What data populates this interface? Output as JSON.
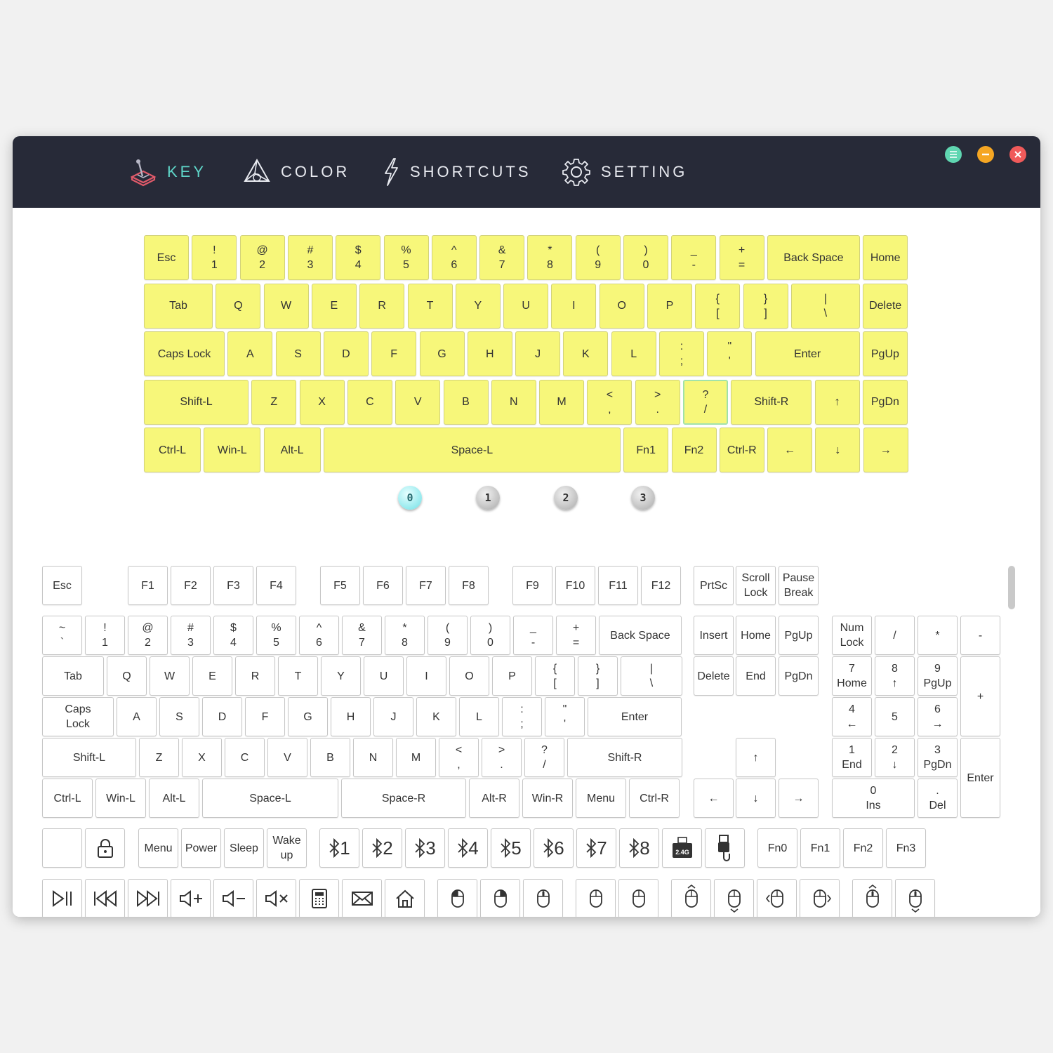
{
  "nav": {
    "key": "KEY",
    "color": "COLOR",
    "shortcuts": "SHORTCUTS",
    "setting": "SETTING"
  },
  "window_buttons": {
    "menu_color": "#5fd6b1",
    "minimize_color": "#f5a623",
    "close_color": "#f05a5a"
  },
  "colors": {
    "accent": "#5fd6c9",
    "key_highlight": "#f7f77a",
    "topbar": "#272a38"
  },
  "layers": [
    "0",
    "1",
    "2",
    "3"
  ],
  "active_layer": "0",
  "keymap_layout_rows": [
    [
      "Esc",
      "! 1",
      "@ 2",
      "# 3",
      "$ 4",
      "% 5",
      "^ 6",
      "& 7",
      "* 8",
      "( 9",
      ") 0",
      "_ -",
      "+ =",
      "Back Space",
      "Home"
    ],
    [
      "Tab",
      "Q",
      "W",
      "E",
      "R",
      "T",
      "Y",
      "U",
      "I",
      "O",
      "P",
      "{ [",
      "} ]",
      "| \\",
      "Delete"
    ],
    [
      "Caps Lock",
      "A",
      "S",
      "D",
      "F",
      "G",
      "H",
      "J",
      "K",
      "L",
      ": ;",
      "\" '",
      "Enter",
      "PgUp"
    ],
    [
      "Shift-L",
      "Z",
      "X",
      "C",
      "V",
      "B",
      "N",
      "M",
      "< ,",
      "> .",
      "? /",
      "Shift-R",
      "↑",
      "PgDn"
    ],
    [
      "Ctrl-L",
      "Win-L",
      "Alt-L",
      "Space-L",
      "Fn1",
      "Fn2",
      "Ctrl-R",
      "←",
      "↓",
      "→"
    ]
  ],
  "selected_key": "? /",
  "palette": {
    "function_row": [
      "Esc",
      "F1",
      "F2",
      "F3",
      "F4",
      "F5",
      "F6",
      "F7",
      "F8",
      "F9",
      "F10",
      "F11",
      "F12",
      "PrtSc",
      "Scroll Lock",
      "Pause Break"
    ],
    "number_row": [
      "~ `",
      "! 1",
      "@ 2",
      "# 3",
      "$ 4",
      "% 5",
      "^ 6",
      "& 7",
      "* 8",
      "( 9",
      ") 0",
      "_ -",
      "+ =",
      "Back Space"
    ],
    "qwerty_row": [
      "Tab",
      "Q",
      "W",
      "E",
      "R",
      "T",
      "Y",
      "U",
      "I",
      "O",
      "P",
      "{ [",
      "} ]",
      "| \\"
    ],
    "home_row": [
      "Caps Lock",
      "A",
      "S",
      "D",
      "F",
      "G",
      "H",
      "J",
      "K",
      "L",
      ": ;",
      "\" '",
      "Enter"
    ],
    "shift_row": [
      "Shift-L",
      "Z",
      "X",
      "C",
      "V",
      "B",
      "N",
      "M",
      "< ,",
      "> .",
      "? /",
      "Shift-R"
    ],
    "bottom_row": [
      "Ctrl-L",
      "Win-L",
      "Alt-L",
      "Space-L",
      "Space-R",
      "Alt-R",
      "Win-R",
      "Menu",
      "Ctrl-R"
    ],
    "nav_cluster": [
      "Insert",
      "Home",
      "PgUp",
      "Delete",
      "End",
      "PgDn",
      "↑",
      "←",
      "↓",
      "→"
    ],
    "numpad": [
      "Num Lock",
      "/",
      "*",
      "-",
      "7 Home",
      "8 ↑",
      "9 PgUp",
      "+",
      "4 ←",
      "5",
      "6 →",
      "1 End",
      "2 ↓",
      "3 PgDn",
      "Enter",
      "0 Ins",
      ". Del"
    ],
    "system_row": [
      "Menu",
      "Power",
      "Sleep",
      "Wake up"
    ],
    "bluetooth": [
      "1",
      "2",
      "3",
      "4",
      "5",
      "6",
      "7",
      "8"
    ],
    "dongle_label": "2.4G",
    "fn_keys": [
      "Fn0",
      "Fn1",
      "Fn2",
      "Fn3"
    ],
    "media_icons": [
      "play-pause-icon",
      "previous-track-icon",
      "next-track-icon",
      "volume-up-icon",
      "volume-down-icon",
      "mute-icon",
      "calculator-icon",
      "mail-icon",
      "home-icon"
    ],
    "mouse_icons": [
      "mouse-left-click-icon",
      "mouse-right-click-icon",
      "mouse-middle-click-icon",
      "mouse-back-icon",
      "mouse-forward-icon",
      "mouse-move-up-icon",
      "mouse-move-down-icon",
      "mouse-move-left-icon",
      "mouse-move-right-icon",
      "mouse-wheel-up-icon",
      "mouse-wheel-down-icon"
    ]
  }
}
